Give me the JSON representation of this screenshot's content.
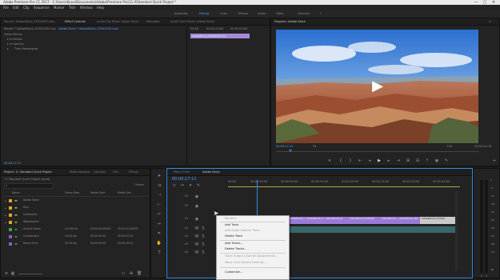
{
  "window": {
    "title": "Adobe Premiere Pro CC 2017 - C:\\Users\\Kunal\\Documents\\Adobe\\Premiere Pro\\11.0\\Standard Quick Project *",
    "controls": [
      "—",
      "▢",
      "✕"
    ]
  },
  "menu": [
    "File",
    "Edit",
    "Clip",
    "Sequence",
    "Marker",
    "Title",
    "Window",
    "Help"
  ],
  "workspaces": [
    "Assembly",
    "Editing",
    "Color",
    "Effects",
    "Audio",
    "Titles",
    "Libraries",
    "»"
  ],
  "source_panel": {
    "tabs": [
      "Source: AdobeStock_97004530.mov",
      "Effect Controls",
      "Audio Clip Mixer: Adobe Stock",
      "Metadata",
      "Audio Track Mixer: Adobe Stock"
    ],
    "master": "Master * AdobeStock_97004530.mov",
    "target": "Adobe Stock * AdobeStock_97004530.mov",
    "section": "Video Effects",
    "effects": [
      "Motion",
      "Opacity",
      "Time Remapping"
    ],
    "mini_time": "00:00",
    "mini_time2": "00:01:00:00",
    "mini_time3": "00:02:00:00",
    "mini_clip": "AdobeStock_97004530.mov",
    "timecode": "00:00:17:11"
  },
  "program_panel": {
    "title": "Program: Adobe Stock",
    "timecode": "00:00:17:11",
    "fit": "Fit",
    "zoom": "Full",
    "duration": "00:02:04:16"
  },
  "project_panel": {
    "tabs": [
      "Project: 11 Standard Quick Project",
      "Media Browser",
      "Libraries",
      "Info",
      "Effects"
    ],
    "path": "11 Standard Quick Project.prproj",
    "count": "7 Items",
    "columns": [
      "Name",
      "Frame Rate",
      "Media Start",
      "Media End"
    ],
    "items": [
      {
        "name": "Adobe Stock",
        "rate": "",
        "start": "",
        "end": "",
        "color": "#e3a52a"
      },
      {
        "name": "Bins",
        "rate": "",
        "start": "",
        "end": "",
        "color": "#e3a52a"
      },
      {
        "name": "Landmarks",
        "rate": "",
        "start": "",
        "end": "",
        "color": "#e3a52a"
      },
      {
        "name": "Waterbound",
        "rate": "",
        "start": "",
        "end": "",
        "color": "#e3a52a"
      },
      {
        "name": "Animal Kracie",
        "rate": "44,100 Hz",
        "start": "00:00:00:00000",
        "end": "00:02:42:18305",
        "color": "#3aa64a"
      },
      {
        "name": "Cumberland",
        "rate": "24.00 fps",
        "start": "00:00:00:00",
        "end": "00:00:05:22",
        "color": "#8b5bc9"
      },
      {
        "name": "Macro Time",
        "rate": "30.00 fps",
        "start": "00:00:00:00",
        "end": "00:00:28:22",
        "color": "#8b5bc9"
      }
    ]
  },
  "timeline": {
    "tabs": [
      "Macro Time",
      "Adobe Stock"
    ],
    "timecode": "00:00:17:11",
    "ruler": [
      "00:00",
      "00:00:15:00",
      "00:00:30:00",
      "00:00:45:00",
      "00:01:00:00",
      "00:01:15:00",
      "00:01:30:00",
      "00:01:45:00"
    ],
    "tracks": [
      "V3",
      "V2",
      "V1",
      "A1",
      "A2",
      "A3",
      "A4"
    ],
    "clips": [
      "AdobeStock_9",
      "AdobeStock_4",
      "AdobeStock_8",
      "AdobeStock_870229",
      "AdobeStock_1",
      "AdobeStock_86",
      "AdobeStock_97004"
    ]
  },
  "context_menu": {
    "items": [
      {
        "label": "Rename",
        "disabled": true
      },
      {
        "label": "Add Track",
        "disabled": false
      },
      {
        "label": "Add Audio Submix Track",
        "disabled": true
      },
      {
        "label": "Delete Track",
        "disabled": false
      },
      {
        "label": "Add Tracks...",
        "disabled": false
      },
      {
        "label": "Delete Tracks...",
        "disabled": false
      },
      {
        "label": "Track Output Channel Assignments...",
        "disabled": true
      },
      {
        "label": "Voice Over Record Settings...",
        "disabled": true
      },
      {
        "label": "Customize...",
        "disabled": false
      }
    ]
  },
  "audio_meter": {
    "labels": [
      "0",
      "-6",
      "-12",
      "-18",
      "-24",
      "-30",
      "-36",
      "-42",
      "-48",
      "-54",
      "dB"
    ]
  },
  "colors": {
    "accent": "#2d8ceb",
    "panel": "#232323",
    "clip_video": "#9a7ad6",
    "clip_audio": "#4aa3a8"
  }
}
